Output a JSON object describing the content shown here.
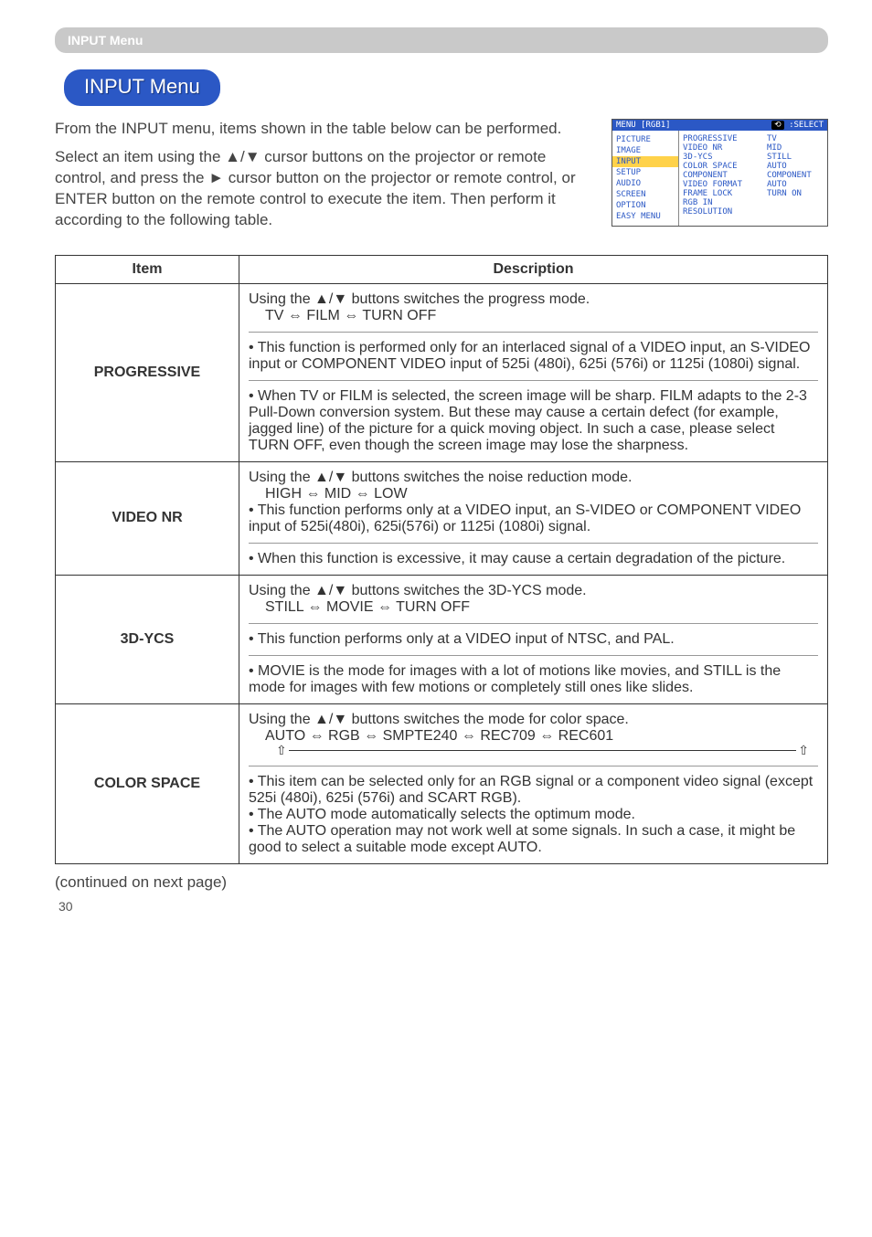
{
  "header_label": "INPUT Menu",
  "title": "INPUT Menu",
  "intro_p1": "From the INPUT menu, items shown in the table below can be performed.",
  "intro_p2": "Select an item using the ▲/▼ cursor buttons on the projector or remote control, and press the ► cursor button on the projector or remote control, or ENTER button on the remote control to execute the item. Then perform it according to the following table.",
  "osd": {
    "menu_label": "MENU [RGB1]",
    "select_icon": "⟲",
    "select_label": ":SELECT",
    "left": [
      "PICTURE",
      "IMAGE",
      "INPUT",
      "SETUP",
      "AUDIO",
      "SCREEN",
      "OPTION",
      "EASY MENU"
    ],
    "highlight_index": 2,
    "right": [
      {
        "k": "PROGRESSIVE",
        "v": "TV"
      },
      {
        "k": "VIDEO NR",
        "v": "MID"
      },
      {
        "k": "3D-YCS",
        "v": "STILL"
      },
      {
        "k": "COLOR SPACE",
        "v": "AUTO"
      },
      {
        "k": "COMPONENT",
        "v": "COMPONENT"
      },
      {
        "k": "VIDEO FORMAT",
        "v": "AUTO"
      },
      {
        "k": "FRAME LOCK",
        "v": "TURN ON"
      },
      {
        "k": "RGB IN",
        "v": ""
      },
      {
        "k": "RESOLUTION",
        "v": ""
      }
    ]
  },
  "table": {
    "h_item": "Item",
    "h_desc": "Description",
    "rows": [
      {
        "item": "PROGRESSIVE",
        "blocks": [
          "Using the ▲/▼ buttons switches the progress mode.",
          "TV ⇔ FILM ⇔ TURN OFF",
          "• This function is performed only for an interlaced signal of a VIDEO input, an S-VIDEO input or COMPONENT VIDEO input of 525i (480i), 625i (576i) or 1125i (1080i) signal.",
          "• When TV or FILM is selected, the screen image will be sharp. FILM adapts to the 2-3 Pull-Down conversion system. But these may cause a certain defect (for example, jagged line) of the picture for a quick moving object. In such a case, please select TURN OFF, even though the screen image may lose the sharpness."
        ]
      },
      {
        "item": "VIDEO NR",
        "blocks": [
          "Using the ▲/▼ buttons switches the noise reduction mode.",
          "HIGH ⇔ MID ⇔ LOW",
          "• This function performs only at a VIDEO input, an S-VIDEO or COMPONENT VIDEO input of 525i(480i), 625i(576i) or 1125i (1080i) signal.",
          "• When this function is excessive, it may cause a certain degradation of the picture."
        ]
      },
      {
        "item": "3D-YCS",
        "blocks": [
          "Using the ▲/▼ buttons switches the 3D-YCS mode.",
          "STILL ⇔ MOVIE ⇔ TURN OFF",
          "• This function performs only at a VIDEO input of NTSC, and PAL.",
          "• MOVIE is the mode for images with a lot of motions like movies, and STILL is the mode for images with few motions or completely still ones like slides."
        ]
      },
      {
        "item": "COLOR SPACE",
        "blocks": [
          "Using the ▲/▼ buttons switches the mode for color space.",
          "AUTO ⇔ RGB ⇔ SMPTE240 ⇔ REC709 ⇔ REC601",
          "__ARROWLINE__",
          "• This item can be selected only for an RGB signal or a component video signal (except 525i (480i), 625i (576i) and SCART RGB).",
          "• The AUTO mode automatically selects the optimum mode.",
          "• The AUTO operation may not work well at some signals. In such a case, it might be good to select a suitable mode except AUTO."
        ]
      }
    ]
  },
  "continued": "(continued on next page)",
  "page_number": "30"
}
